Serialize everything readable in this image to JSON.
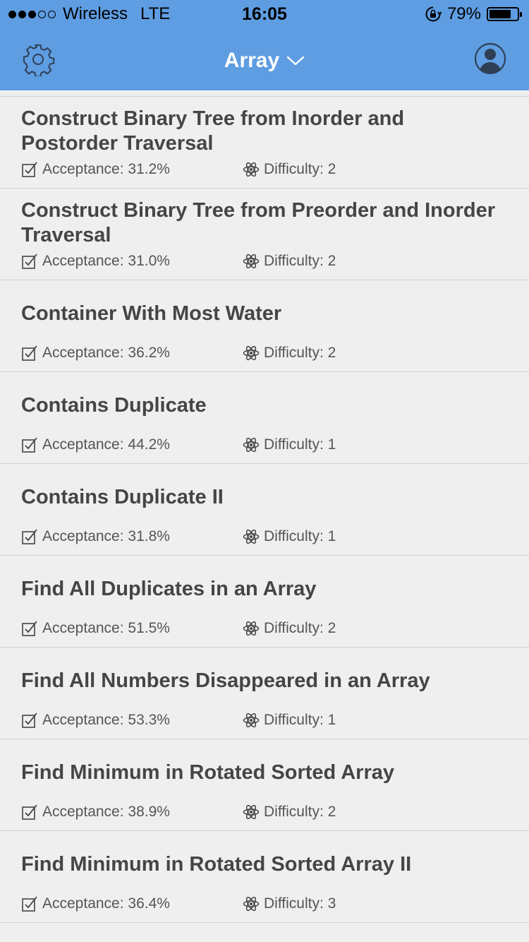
{
  "status_bar": {
    "carrier": "Wireless",
    "network": "LTE",
    "time": "16:05",
    "battery": "79%",
    "battery_level": 0.79,
    "signal_bars": 3
  },
  "nav": {
    "title": "Array",
    "left_icon": "gear-icon",
    "right_icon": "user-avatar-icon",
    "title_icon": "chevron-down-icon"
  },
  "colors": {
    "header": "#5e9de2",
    "background": "#efefef",
    "text": "#454545",
    "divider": "#cfcfcf"
  },
  "problems": [
    {
      "title": "Construct Binary Tree from Inorder and Postorder Traversal",
      "acceptance": "Acceptance: 31.2%",
      "difficulty": "Difficulty: 2"
    },
    {
      "title": "Construct Binary Tree from Preorder and Inorder Traversal",
      "acceptance": "Acceptance: 31.0%",
      "difficulty": "Difficulty: 2"
    },
    {
      "title": "Container With Most Water",
      "acceptance": "Acceptance: 36.2%",
      "difficulty": "Difficulty: 2"
    },
    {
      "title": "Contains Duplicate",
      "acceptance": "Acceptance: 44.2%",
      "difficulty": "Difficulty: 1"
    },
    {
      "title": "Contains Duplicate II",
      "acceptance": "Acceptance: 31.8%",
      "difficulty": "Difficulty: 1"
    },
    {
      "title": "Find All Duplicates in an Array",
      "acceptance": "Acceptance: 51.5%",
      "difficulty": "Difficulty: 2"
    },
    {
      "title": "Find All Numbers Disappeared in an Array",
      "acceptance": "Acceptance: 53.3%",
      "difficulty": "Difficulty: 1"
    },
    {
      "title": "Find Minimum in Rotated Sorted Array",
      "acceptance": "Acceptance: 38.9%",
      "difficulty": "Difficulty: 2"
    },
    {
      "title": "Find Minimum in Rotated Sorted Array II",
      "acceptance": "Acceptance: 36.4%",
      "difficulty": "Difficulty: 3"
    }
  ]
}
